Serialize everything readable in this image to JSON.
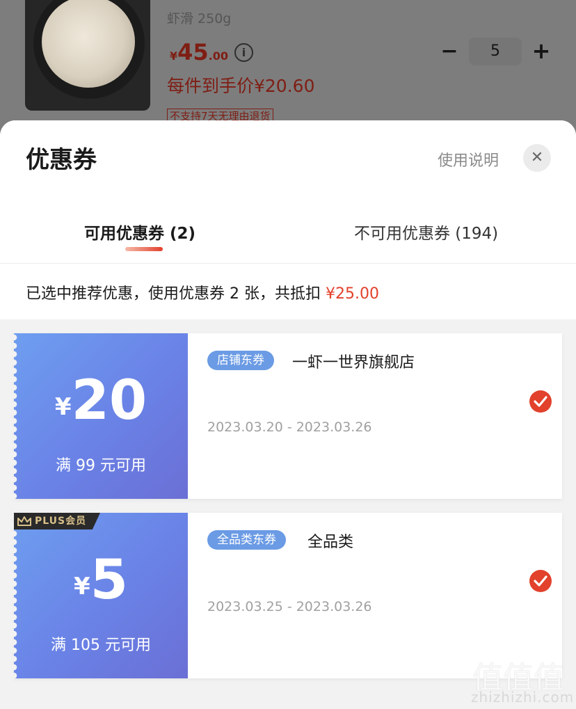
{
  "product": {
    "name": "虾滑 250g",
    "price_currency": "¥",
    "price_integer": "45",
    "price_decimal": ".00",
    "info_icon": "i",
    "final_price": "每件到手价¥20.60",
    "return_tag": "不支持7天无理由退货",
    "quantity": "5",
    "minus_label": "−",
    "plus_label": "+"
  },
  "sheet": {
    "title": "优惠券",
    "help_link": "使用说明",
    "close_label": "✕",
    "tabs": [
      {
        "label": "可用优惠券 (2)",
        "active": true
      },
      {
        "label": "不可用优惠券 (194)",
        "active": false
      }
    ],
    "summary_text": "已选中推荐优惠，使用优惠券 2 张，共抵扣 ",
    "summary_amount": "¥25.00"
  },
  "coupons": [
    {
      "currency": "¥",
      "amount": "20",
      "condition": "满 99 元可用",
      "badge": "店铺东券",
      "scope": "一虾一世界旗舰店",
      "period": "2023.03.20 - 2023.03.26",
      "selected": true,
      "plus_tag": ""
    },
    {
      "currency": "¥",
      "amount": "5",
      "condition": "满 105 元可用",
      "badge": "全品类东券",
      "scope": "全品类",
      "period": "2023.03.25 - 2023.03.26",
      "selected": true,
      "plus_tag": "PLUS会员"
    }
  ],
  "watermark": {
    "logo": "值值值",
    "url": "zhizhizhi.com"
  },
  "colors": {
    "accent": "#e2412c",
    "coupon_gradient_start": "#6e9ef0",
    "coupon_gradient_end": "#6b6fd5",
    "badge": "#6b9be4"
  }
}
